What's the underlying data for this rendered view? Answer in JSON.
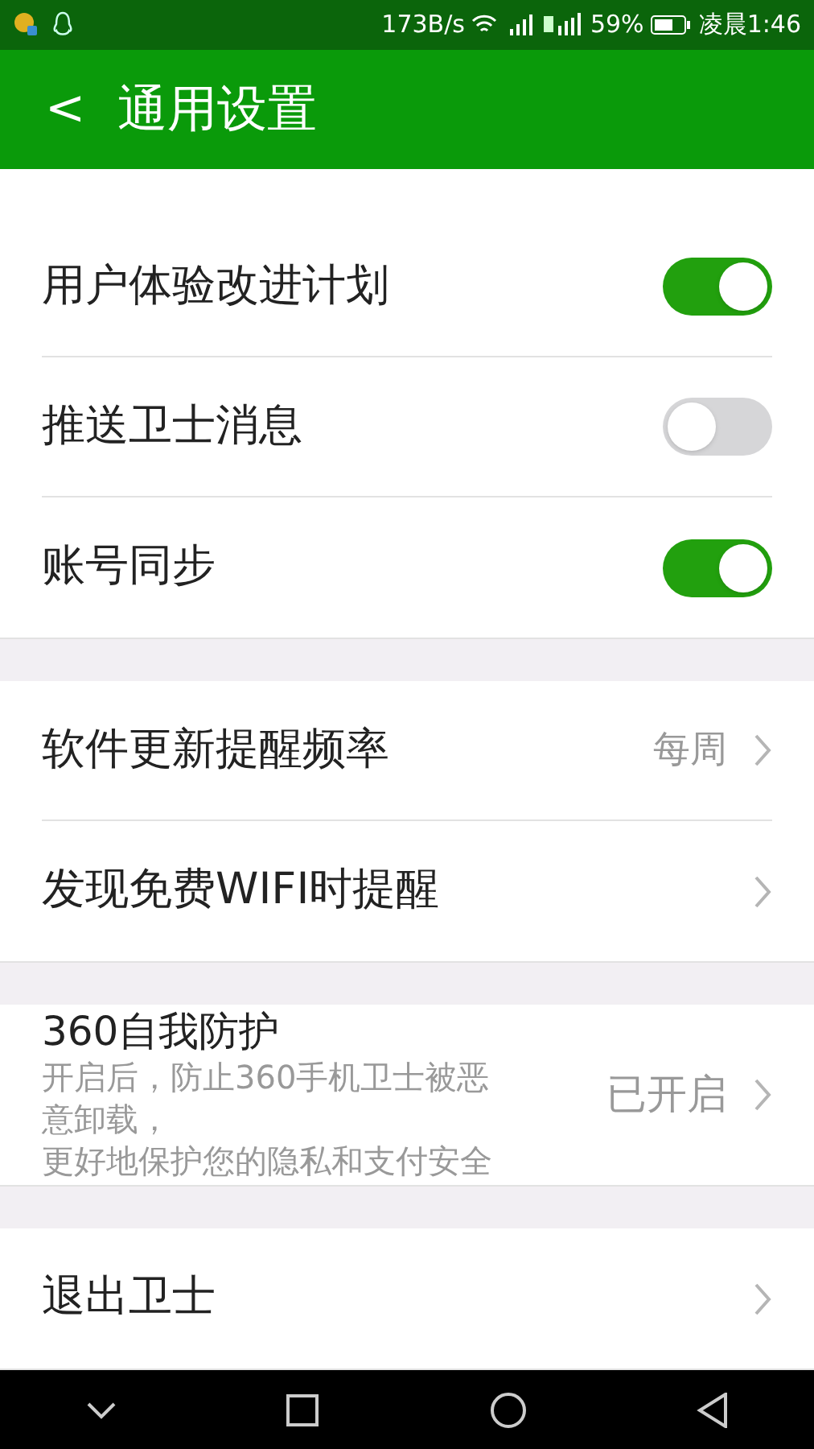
{
  "status_bar": {
    "speed": "173B/s",
    "battery": "59%",
    "time": "凌晨1:46"
  },
  "header": {
    "back": "<",
    "title": "通用设置"
  },
  "groups": [
    {
      "rows": [
        {
          "kind": "toggle",
          "label": "用户体验改进计划",
          "on": true
        },
        {
          "kind": "toggle",
          "label": "推送卫士消息",
          "on": false
        },
        {
          "kind": "toggle",
          "label": "账号同步",
          "on": true
        }
      ]
    },
    {
      "rows": [
        {
          "kind": "link",
          "label": "软件更新提醒频率",
          "value": "每周"
        },
        {
          "kind": "link",
          "label": "发现免费WIFI时提醒"
        }
      ]
    },
    {
      "rows": [
        {
          "kind": "detail",
          "label": "360自我防护",
          "description": [
            "开启后，防止360手机卫士被恶",
            "意卸载，",
            "更好地保护您的隐私和支付安全"
          ],
          "value": "已开启"
        }
      ]
    },
    {
      "rows": [
        {
          "kind": "link",
          "label": "退出卫士"
        }
      ]
    }
  ]
}
